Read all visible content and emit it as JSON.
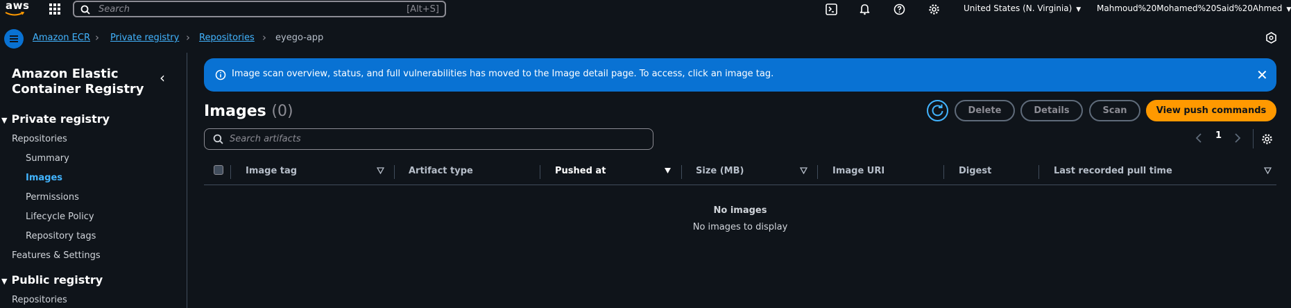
{
  "topbar": {
    "logo_text": "aws",
    "search_placeholder": "Search",
    "search_shortcut": "[Alt+S]",
    "region": "United States (N. Virginia)",
    "user": "Mahmoud%20Mohamed%20Said%20Ahmed"
  },
  "breadcrumb": {
    "items": [
      "Amazon ECR",
      "Private registry",
      "Repositories"
    ],
    "current": "eyego-app"
  },
  "sidebar": {
    "title": "Amazon Elastic Container Registry",
    "sections": [
      {
        "label": "Private registry"
      },
      {
        "label": "Public registry"
      }
    ],
    "items": {
      "repositories": "Repositories",
      "summary": "Summary",
      "images": "Images",
      "permissions": "Permissions",
      "lifecycle": "Lifecycle Policy",
      "repo_tags": "Repository tags",
      "features": "Features & Settings",
      "public_repositories": "Repositories"
    }
  },
  "flash": {
    "message": "Image scan overview, status, and full vulnerabilities has moved to the Image detail page. To access, click an image tag."
  },
  "main": {
    "heading": "Images",
    "count": "(0)",
    "buttons": {
      "delete": "Delete",
      "details": "Details",
      "scan": "Scan",
      "push": "View push commands"
    },
    "search_placeholder": "Search artifacts",
    "page": "1",
    "columns": [
      "Image tag",
      "Artifact type",
      "Pushed at",
      "Size (MB)",
      "Image URI",
      "Digest",
      "Last recorded pull time"
    ],
    "empty_title": "No images",
    "empty_subtitle": "No images to display"
  },
  "colors": {
    "background": "#0f141a",
    "accent": "#0972d3",
    "link": "#42b4ff",
    "primary_button": "#ff9900"
  }
}
